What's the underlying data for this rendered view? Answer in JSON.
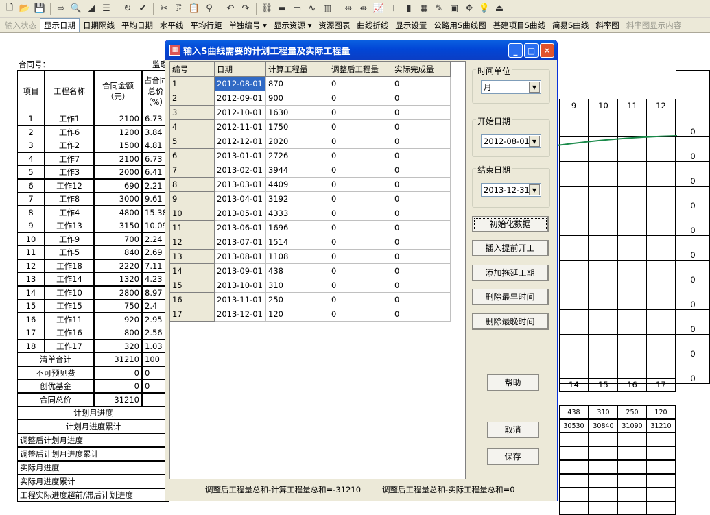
{
  "toolbar1": {
    "icons": [
      "new-file-icon",
      "open-folder-icon",
      "save-icon",
      "export-icon",
      "print-preview-icon",
      "triangle-icon",
      "indent-icon",
      "refresh-icon",
      "check-icon",
      "cut-icon",
      "copy-icon",
      "paste-icon",
      "find-icon",
      "undo-icon",
      "redo-icon",
      "link-icon",
      "bar-red-icon",
      "box-red-icon",
      "curve-icon",
      "resource-icon",
      "split-icon",
      "merge-icon",
      "chart-edit-icon",
      "level-icon",
      "column-chart-icon",
      "calc-icon",
      "pen-icon",
      "film-icon",
      "move-icon",
      "bulb-icon",
      "exit-icon"
    ]
  },
  "toolbar2": {
    "items": [
      {
        "label": "输入状态",
        "state": "disabled"
      },
      {
        "label": "显示日期",
        "state": "active"
      },
      {
        "label": "日期隔线",
        "state": "normal"
      },
      {
        "label": "平均日期",
        "state": "normal"
      },
      {
        "label": "水平线",
        "state": "normal"
      },
      {
        "label": "平均行距",
        "state": "normal"
      },
      {
        "label": "单独编号 ▾",
        "state": "normal"
      },
      {
        "label": "显示资源 ▾",
        "state": "normal"
      },
      {
        "label": "资源图表",
        "state": "normal"
      },
      {
        "label": "曲线折线",
        "state": "normal"
      },
      {
        "label": "显示设置",
        "state": "normal"
      },
      {
        "label": "公路用S曲线图",
        "state": "normal"
      },
      {
        "label": "基建项目S曲线",
        "state": "normal"
      },
      {
        "label": "简易S曲线",
        "state": "normal"
      },
      {
        "label": "斜率图",
        "state": "normal"
      },
      {
        "label": "斜率图显示内容",
        "state": "disabled"
      }
    ]
  },
  "sheet": {
    "contract_label": "合同号：",
    "supervisor_label": "监理",
    "headers": {
      "item": "项目",
      "name": "工程名称",
      "amount": "合同金额\n（元）",
      "pct": "占合同\n总价\n（%）"
    },
    "rows": [
      {
        "no": "1",
        "name": "工作1",
        "amount": "2100",
        "pct": "6.73"
      },
      {
        "no": "2",
        "name": "工作6",
        "amount": "1200",
        "pct": "3.84"
      },
      {
        "no": "3",
        "name": "工作2",
        "amount": "1500",
        "pct": "4.81"
      },
      {
        "no": "4",
        "name": "工作7",
        "amount": "2100",
        "pct": "6.73"
      },
      {
        "no": "5",
        "name": "工作3",
        "amount": "2000",
        "pct": "6.41"
      },
      {
        "no": "6",
        "name": "工作12",
        "amount": "690",
        "pct": "2.21"
      },
      {
        "no": "7",
        "name": "工作8",
        "amount": "3000",
        "pct": "9.61"
      },
      {
        "no": "8",
        "name": "工作4",
        "amount": "4800",
        "pct": "15.38"
      },
      {
        "no": "9",
        "name": "工作13",
        "amount": "3150",
        "pct": "10.09"
      },
      {
        "no": "10",
        "name": "工作9",
        "amount": "700",
        "pct": "2.24"
      },
      {
        "no": "11",
        "name": "工作5",
        "amount": "840",
        "pct": "2.69"
      },
      {
        "no": "12",
        "name": "工作18",
        "amount": "2220",
        "pct": "7.11"
      },
      {
        "no": "13",
        "name": "工作14",
        "amount": "1320",
        "pct": "4.23"
      },
      {
        "no": "14",
        "name": "工作10",
        "amount": "2800",
        "pct": "8.97"
      },
      {
        "no": "15",
        "name": "工作15",
        "amount": "750",
        "pct": "2.4"
      },
      {
        "no": "16",
        "name": "工作11",
        "amount": "920",
        "pct": "2.95"
      },
      {
        "no": "17",
        "name": "工作16",
        "amount": "800",
        "pct": "2.56"
      },
      {
        "no": "18",
        "name": "工作17",
        "amount": "320",
        "pct": "1.03"
      }
    ],
    "summary": [
      {
        "label": "清单合计",
        "amount": "31210",
        "pct": "100"
      },
      {
        "label": "不可预见费",
        "amount": "0",
        "pct": "0"
      },
      {
        "label": "创优基金",
        "amount": "0",
        "pct": "0"
      },
      {
        "label": "合同总价",
        "amount": "31210",
        "pct": ""
      }
    ],
    "progress_rows": [
      "计划月进度",
      "计划月进度累计",
      "调整后计划月进度",
      "调整后计划月进度累计",
      "实际月进度",
      "实际月进度累计",
      "工程实际进度超前/滞后计划进度"
    ],
    "months_top": [
      "9",
      "10",
      "11",
      "12"
    ],
    "months_bottom": [
      "14",
      "15",
      "16",
      "17"
    ],
    "plan_month": [
      "438",
      "310",
      "250",
      "120"
    ],
    "plan_cum": [
      "30530",
      "30840",
      "31090",
      "31210"
    ],
    "right_zeros": [
      "0",
      "0",
      "0",
      "0",
      "0",
      "0",
      "0",
      "0",
      "0",
      "0",
      "0"
    ]
  },
  "dialog": {
    "title": "输入S曲线需要的计划工程量及实际工程量",
    "columns": [
      "编号",
      "日期",
      "计算工程量",
      "调整后工程量",
      "实际完成量"
    ],
    "rows": [
      {
        "no": "1",
        "date": "2012-08-01",
        "calc": "870",
        "adj": "0",
        "actual": "0"
      },
      {
        "no": "2",
        "date": "2012-09-01",
        "calc": "900",
        "adj": "0",
        "actual": "0"
      },
      {
        "no": "3",
        "date": "2012-10-01",
        "calc": "1630",
        "adj": "0",
        "actual": "0"
      },
      {
        "no": "4",
        "date": "2012-11-01",
        "calc": "1750",
        "adj": "0",
        "actual": "0"
      },
      {
        "no": "5",
        "date": "2012-12-01",
        "calc": "2020",
        "adj": "0",
        "actual": "0"
      },
      {
        "no": "6",
        "date": "2013-01-01",
        "calc": "2726",
        "adj": "0",
        "actual": "0"
      },
      {
        "no": "7",
        "date": "2013-02-01",
        "calc": "3944",
        "adj": "0",
        "actual": "0"
      },
      {
        "no": "8",
        "date": "2013-03-01",
        "calc": "4409",
        "adj": "0",
        "actual": "0"
      },
      {
        "no": "9",
        "date": "2013-04-01",
        "calc": "3192",
        "adj": "0",
        "actual": "0"
      },
      {
        "no": "10",
        "date": "2013-05-01",
        "calc": "4333",
        "adj": "0",
        "actual": "0"
      },
      {
        "no": "11",
        "date": "2013-06-01",
        "calc": "1696",
        "adj": "0",
        "actual": "0"
      },
      {
        "no": "12",
        "date": "2013-07-01",
        "calc": "1514",
        "adj": "0",
        "actual": "0"
      },
      {
        "no": "13",
        "date": "2013-08-01",
        "calc": "1108",
        "adj": "0",
        "actual": "0"
      },
      {
        "no": "14",
        "date": "2013-09-01",
        "calc": "438",
        "adj": "0",
        "actual": "0"
      },
      {
        "no": "15",
        "date": "2013-10-01",
        "calc": "310",
        "adj": "0",
        "actual": "0"
      },
      {
        "no": "16",
        "date": "2013-11-01",
        "calc": "250",
        "adj": "0",
        "actual": "0"
      },
      {
        "no": "17",
        "date": "2013-12-01",
        "calc": "120",
        "adj": "0",
        "actual": "0"
      }
    ],
    "time_unit": {
      "label": "时间单位",
      "value": "月"
    },
    "start_date": {
      "label": "开始日期",
      "value": "2012-08-01"
    },
    "end_date": {
      "label": "结束日期",
      "value": "2013-12-31"
    },
    "buttons": {
      "init": "初始化数据",
      "insert_early": "插入提前开工",
      "add_delay": "添加拖延工期",
      "del_earliest": "删除最早时间",
      "del_latest": "删除最晚时间",
      "help": "帮助",
      "cancel": "取消",
      "save": "保存"
    },
    "status_left": "调整后工程量总和-计算工程量总和=-31210",
    "status_right": "调整后工程量总和-实际工程量总和=0"
  }
}
